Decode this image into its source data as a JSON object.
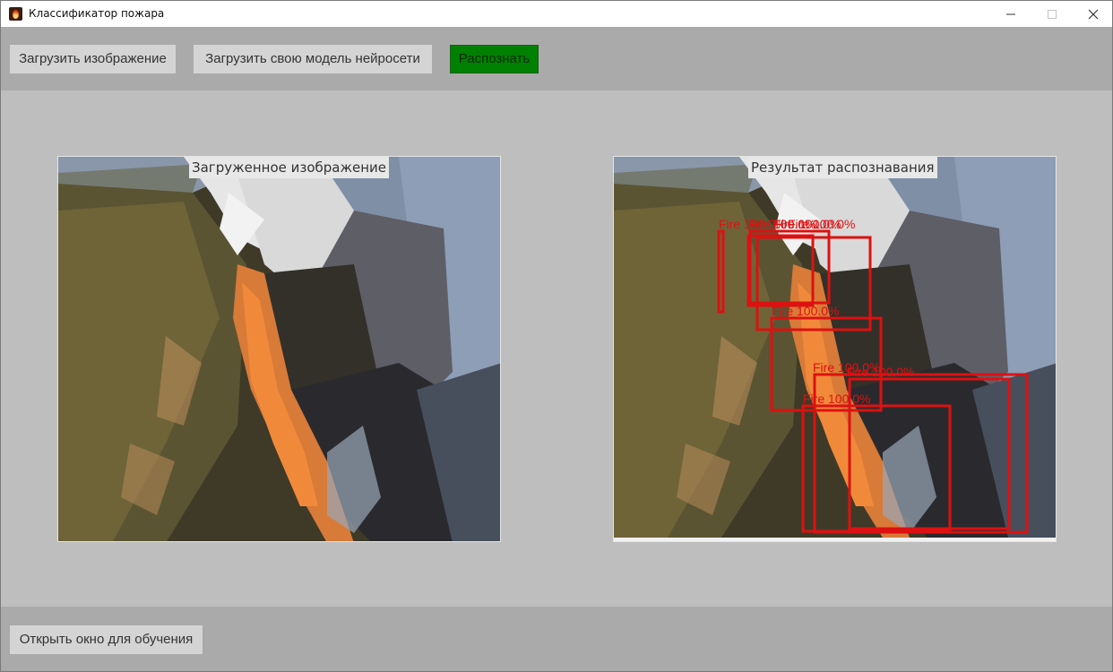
{
  "window": {
    "title": "Классификатор пожара",
    "controls": {
      "minimize": "–",
      "maximize": "☐",
      "close": "✕"
    }
  },
  "toolbar": {
    "load_image_label": "Загрузить изображение",
    "load_model_label": "Загрузить свою модель нейросети",
    "recognize_label": "Распознать",
    "recognize_color": "#008000"
  },
  "panels": {
    "source": {
      "caption": "Загруженное изображение"
    },
    "result": {
      "caption": "Результат распознавания",
      "detection_color": "#dd1111",
      "detections": [
        {
          "label": "Fire",
          "confidence": "100.0%"
        },
        {
          "label": "Fire",
          "confidence": "100.0%"
        },
        {
          "label": "Fire",
          "confidence": "100.0%"
        },
        {
          "label": "Fire",
          "confidence": "100.0%"
        },
        {
          "label": "Fire",
          "confidence": "100.0%"
        },
        {
          "label": "Fire",
          "confidence": "100.0%"
        },
        {
          "label": "Fire",
          "confidence": "100.0%"
        },
        {
          "label": "Fire",
          "confidence": "100.0%"
        }
      ]
    }
  },
  "footer": {
    "train_window_label": "Открыть окно для обучения"
  }
}
